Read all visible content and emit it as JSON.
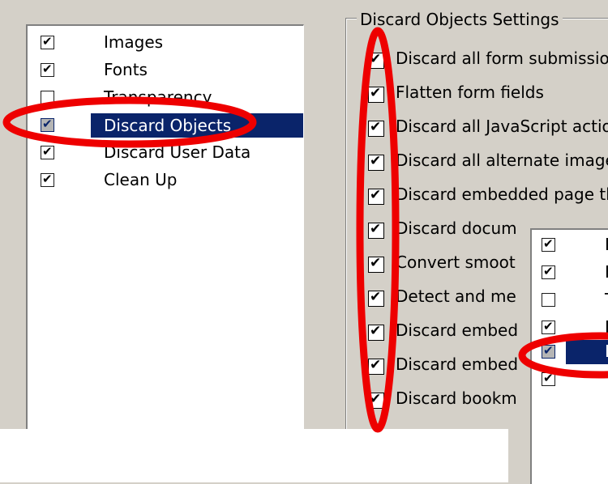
{
  "left_list": [
    {
      "label": "Images",
      "checked": true,
      "selected": false
    },
    {
      "label": "Fonts",
      "checked": true,
      "selected": false
    },
    {
      "label": "Transparency",
      "checked": false,
      "selected": false
    },
    {
      "label": "Discard Objects",
      "checked": true,
      "selected": true
    },
    {
      "label": "Discard User Data",
      "checked": true,
      "selected": false
    },
    {
      "label": "Clean Up",
      "checked": true,
      "selected": false
    }
  ],
  "settings": {
    "legend": "Discard Objects Settings",
    "options": [
      "Discard all form submission,",
      "Flatten form fields",
      "Discard all JavaScript action",
      "Discard all alternate images",
      "Discard embedded page thu",
      "Discard docum",
      "Convert smoot",
      "Detect and me",
      "Discard embed",
      "Discard embed",
      "Discard bookm"
    ]
  },
  "popup_list": {
    "items": [
      {
        "label": "I",
        "checked": true,
        "selected": false
      },
      {
        "label": "F",
        "checked": true,
        "selected": false
      },
      {
        "label": "T",
        "checked": false,
        "selected": false
      },
      {
        "label": "D",
        "checked": true,
        "selected": false
      },
      {
        "label": "D",
        "checked": true,
        "selected": true
      },
      {
        "label": "",
        "checked": true,
        "selected": false
      }
    ]
  },
  "annotation": {
    "color": "#ee0000"
  }
}
